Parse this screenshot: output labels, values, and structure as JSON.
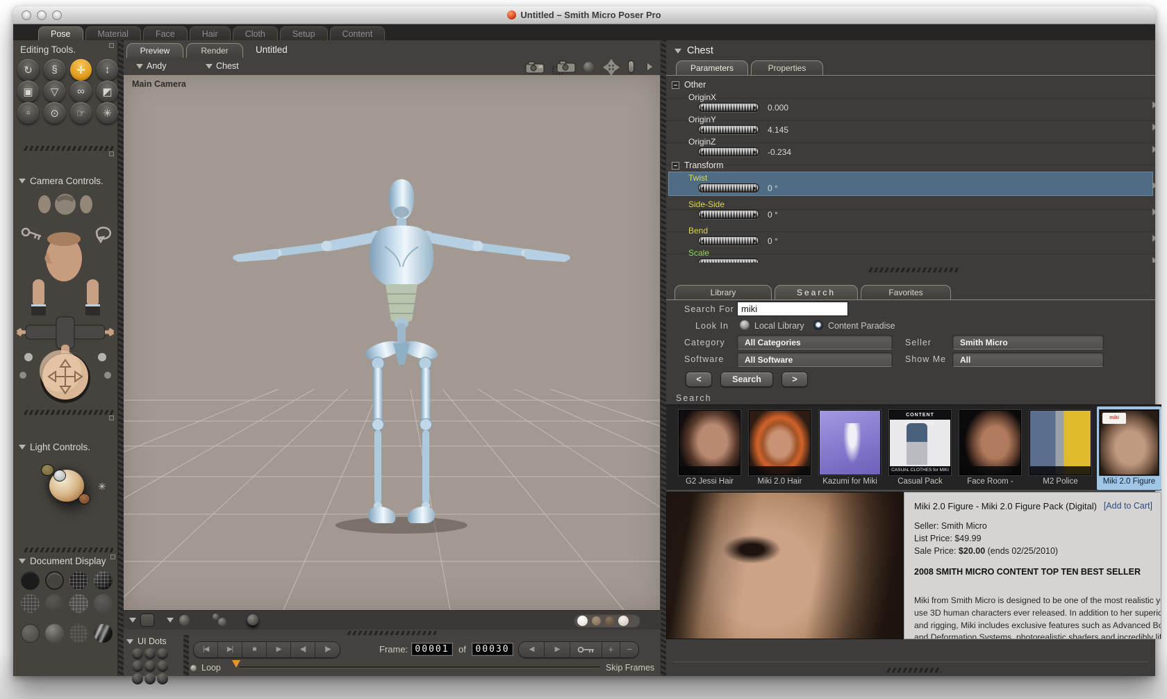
{
  "window": {
    "title": "Untitled – Smith Micro Poser Pro"
  },
  "main_tabs": {
    "items": [
      {
        "label": "Pose"
      },
      {
        "label": "Material"
      },
      {
        "label": "Face"
      },
      {
        "label": "Hair"
      },
      {
        "label": "Cloth"
      },
      {
        "label": "Setup"
      },
      {
        "label": "Content"
      }
    ]
  },
  "sidebar": {
    "editing_tools": {
      "title": "Editing Tools.",
      "tools": [
        {
          "name": "rotate",
          "glyph": "↻"
        },
        {
          "name": "twist",
          "glyph": "§"
        },
        {
          "name": "translate-pull",
          "glyph": "✛"
        },
        {
          "name": "translate-in-out",
          "glyph": "↕"
        },
        {
          "name": "scale",
          "glyph": "▣"
        },
        {
          "name": "taper",
          "glyph": "▽"
        },
        {
          "name": "chain-break",
          "glyph": "∞"
        },
        {
          "name": "color",
          "glyph": "◩"
        },
        {
          "name": "morphing-tool",
          "glyph": "▫"
        },
        {
          "name": "zoom",
          "glyph": "⊙"
        },
        {
          "name": "grouping",
          "glyph": "☞"
        },
        {
          "name": "view-magnifier",
          "glyph": "✳"
        }
      ]
    },
    "camera_controls": {
      "title": "Camera Controls."
    },
    "light_controls": {
      "title": "Light Controls.",
      "sun_glyph": "✳"
    },
    "document_display": {
      "title": "Document Display"
    }
  },
  "document": {
    "tabs": [
      {
        "label": "Preview"
      },
      {
        "label": "Render"
      }
    ],
    "title": "Untitled",
    "actor": "Andy",
    "element": "Chest",
    "camera_label": "Main Camera"
  },
  "parameters_panel": {
    "header": "Chest",
    "tabs": [
      {
        "label": "Parameters"
      },
      {
        "label": "Properties"
      }
    ],
    "group_other": "Other",
    "group_transform": "Transform",
    "params": {
      "originx": {
        "label": "OriginX",
        "value": "0.000"
      },
      "originy": {
        "label": "OriginY",
        "value": "4.145"
      },
      "originz": {
        "label": "OriginZ",
        "value": "-0.234"
      },
      "twist": {
        "label": "Twist",
        "value": "0 °"
      },
      "sideside": {
        "label": "Side-Side",
        "value": "0 °"
      },
      "bend": {
        "label": "Bend",
        "value": "0 °"
      },
      "scale": {
        "label": "Scale",
        "value": ""
      }
    }
  },
  "library_panel": {
    "tabs": [
      {
        "label": "Library"
      },
      {
        "label": "Search"
      },
      {
        "label": "Favorites"
      }
    ],
    "form": {
      "search_for_label": "Search For",
      "search_value": "miki",
      "look_in_label": "Look In",
      "local_library_label": "Local Library",
      "content_paradise_label": "Content Paradise",
      "category_label": "Category",
      "category_value": "All Categories",
      "seller_label": "Seller",
      "seller_value": "Smith Micro",
      "software_label": "Software",
      "software_value": "All Software",
      "show_me_label": "Show Me",
      "show_me_value": "All",
      "prev_label": "<",
      "search_button_label": "Search",
      "next_label": ">"
    },
    "results_header": "Search",
    "results": [
      {
        "label": "G2 Jessi Hair"
      },
      {
        "label": "Miki 2.0 Hair"
      },
      {
        "label": "Kazumi for Miki"
      },
      {
        "label": "Casual Pack",
        "overlay_top": "CONTENT PARADISE",
        "overlay_bottom": "CASUAL CLOTHES for MIKI"
      },
      {
        "label": "Face Room -"
      },
      {
        "label": "M2 Police"
      },
      {
        "label": "Miki 2.0 Figure",
        "chip": "miki"
      }
    ],
    "detail": {
      "title": "Miki 2.0 Figure - Miki 2.0 Figure Pack (Digital)",
      "add_to_cart": "[Add to Cart]",
      "seller": "Seller: Smith Micro",
      "list_price": "List Price: $49.99",
      "sale_price_label": "Sale Price: ",
      "sale_price_value": "$20.00",
      "sale_price_suffix": " (ends 02/25/2010)",
      "banner": "2008 SMITH MICRO CONTENT TOP TEN BEST SELLER",
      "description": "Miki from Smith Micro is designed to be one of the most realistic yet easy to use 3D human characters ever released. In addition to her superior modeling and rigging, Miki includes exclusive features such as Advanced Body Control and Deformation Systems, photorealistic shaders and incredibly life-like facial expression morphs similar to those delivered in Generation 2 (G2) figures. Miki is Poser Face Room compatible, and is one of the most advanced and versatile Poser characters available today."
    }
  },
  "animation": {
    "ui_dots_label": "UI Dots",
    "transport": [
      {
        "glyph": "|◀"
      },
      {
        "glyph": "▶|"
      },
      {
        "glyph": "■"
      },
      {
        "glyph": "▶"
      },
      {
        "glyph": "◀|"
      },
      {
        "glyph": "|▶"
      }
    ],
    "frame_label": "Frame:",
    "frame_value": "00001",
    "of_label": "of",
    "total_frames": "00030",
    "key_prev": "◀",
    "key_next": "▶",
    "add_key": "+",
    "remove_key": "−",
    "loop_label": "Loop",
    "skip_frames_label": "Skip Frames"
  },
  "colors": {
    "accent_orange": "#e29c1f",
    "selection_blue": "#9fc6e7",
    "highlight_row": "#4e6d85"
  }
}
